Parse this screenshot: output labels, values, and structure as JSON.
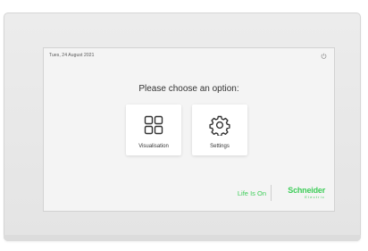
{
  "header": {
    "date": "Tues, 24 August 2021",
    "power_icon": "power-icon"
  },
  "main": {
    "prompt": "Please choose an option:",
    "options": [
      {
        "label": "Visualisation",
        "icon": "grid-icon"
      },
      {
        "label": "Settings",
        "icon": "gear-icon"
      }
    ]
  },
  "branding": {
    "tagline": "Life Is On",
    "company": "Schneider",
    "company_sub": "Electric",
    "color": "#3dcd58"
  }
}
